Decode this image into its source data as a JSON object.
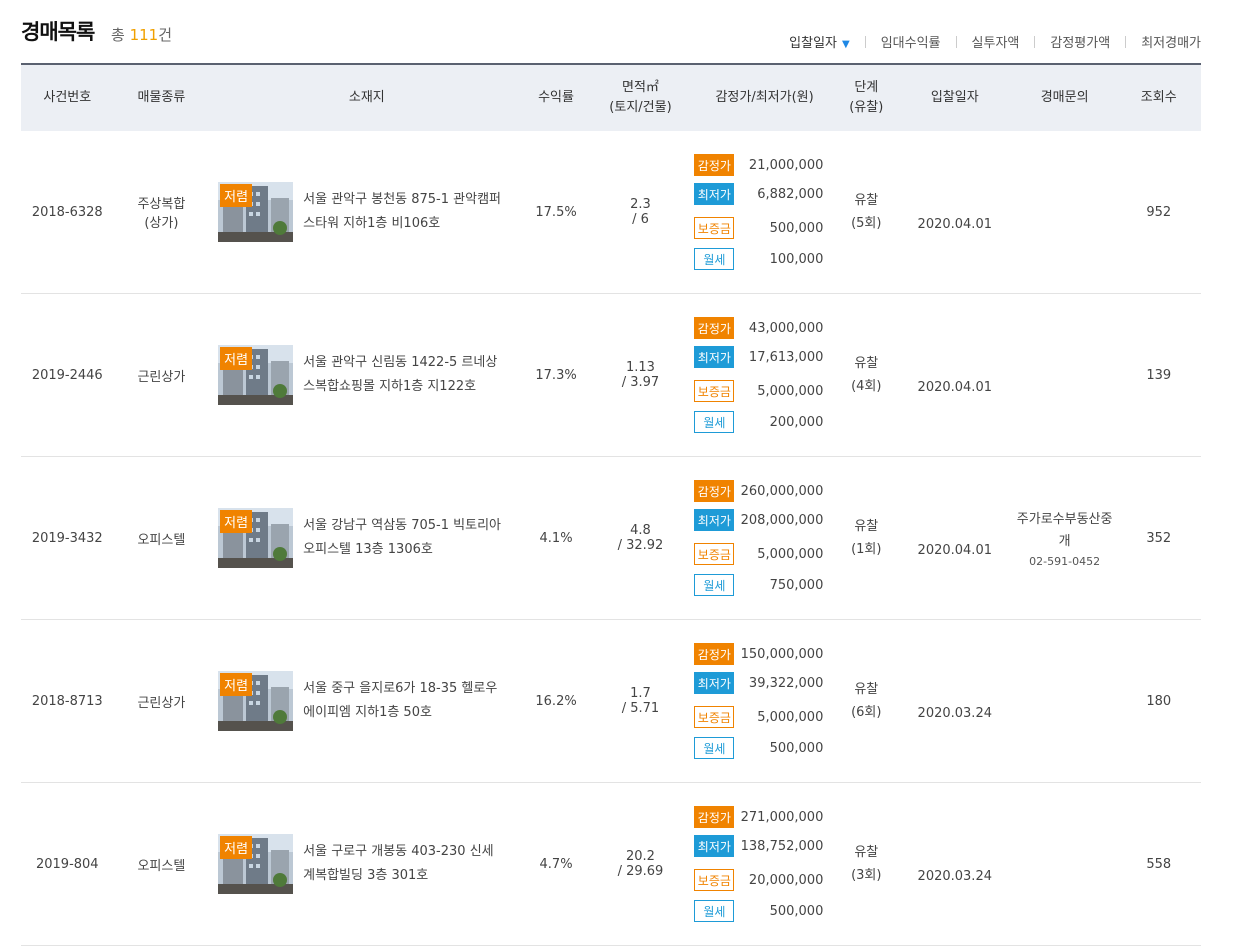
{
  "header": {
    "title": "경매목록",
    "count_prefix": "총 ",
    "count": "111",
    "count_suffix": "건"
  },
  "sort_options": [
    {
      "label": "입찰일자",
      "active": true,
      "icon": "caret-down-icon"
    },
    {
      "label": "임대수익률"
    },
    {
      "label": "실투자액"
    },
    {
      "label": "감정평가액"
    },
    {
      "label": "최저경매가"
    }
  ],
  "columns": {
    "case_no": "사건번호",
    "type": "매물종류",
    "location": "소재지",
    "yield": "수익률",
    "area_l1": "면적㎡",
    "area_l2": "(토지/건물)",
    "price": "감정가/최저가(원)",
    "stage_l1": "단계",
    "stage_l2": "(유찰)",
    "bid_date": "입찰일자",
    "inquiry": "경매문의",
    "views": "조회수"
  },
  "price_labels": {
    "appraisal": "감정가",
    "minimum": "최저가",
    "deposit": "보증금",
    "rent": "월세"
  },
  "thumb_badge": "저렴",
  "rows": [
    {
      "case_no": "2018-6328",
      "type_l1": "주상복합",
      "type_l2": "(상가)",
      "address": "서울 관악구 봉천동 875-1 관악캠퍼스타워 지하1층 비106호",
      "yield": "17.5%",
      "area_l1": "2.3",
      "area_l2": "/ 6",
      "appraisal": "21,000,000",
      "minimum": "6,882,000",
      "deposit": "500,000",
      "rent": "100,000",
      "stage_l1": "유찰",
      "stage_l2": "(5회)",
      "bid_date": "2020.04.01",
      "inquiry_l1": "",
      "inquiry_l2": "",
      "inquiry_phone": "",
      "views": "952"
    },
    {
      "case_no": "2019-2446",
      "type_l1": "근린상가",
      "type_l2": "",
      "address": "서울 관악구 신림동 1422-5 르네상스복합쇼핑몰 지하1층 지122호",
      "yield": "17.3%",
      "area_l1": "1.13",
      "area_l2": "/ 3.97",
      "appraisal": "43,000,000",
      "minimum": "17,613,000",
      "deposit": "5,000,000",
      "rent": "200,000",
      "stage_l1": "유찰",
      "stage_l2": "(4회)",
      "bid_date": "2020.04.01",
      "inquiry_l1": "",
      "inquiry_l2": "",
      "inquiry_phone": "",
      "views": "139"
    },
    {
      "case_no": "2019-3432",
      "type_l1": "오피스텔",
      "type_l2": "",
      "address": "서울 강남구 역삼동 705-1 빅토리아오피스텔 13층 1306호",
      "yield": "4.1%",
      "area_l1": "4.8",
      "area_l2": "/ 32.92",
      "appraisal": "260,000,000",
      "minimum": "208,000,000",
      "deposit": "5,000,000",
      "rent": "750,000",
      "stage_l1": "유찰",
      "stage_l2": "(1회)",
      "bid_date": "2020.04.01",
      "inquiry_l1": "주가로수부동산중",
      "inquiry_l2": "개",
      "inquiry_phone": "02-591-0452",
      "views": "352"
    },
    {
      "case_no": "2018-8713",
      "type_l1": "근린상가",
      "type_l2": "",
      "address": "서울 중구 을지로6가 18-35 헬로우에이피엠 지하1층 50호",
      "yield": "16.2%",
      "area_l1": "1.7",
      "area_l2": "/ 5.71",
      "appraisal": "150,000,000",
      "minimum": "39,322,000",
      "deposit": "5,000,000",
      "rent": "500,000",
      "stage_l1": "유찰",
      "stage_l2": "(6회)",
      "bid_date": "2020.03.24",
      "inquiry_l1": "",
      "inquiry_l2": "",
      "inquiry_phone": "",
      "views": "180"
    },
    {
      "case_no": "2019-804",
      "type_l1": "오피스텔",
      "type_l2": "",
      "address": "서울 구로구 개봉동 403-230 신세계복합빌딩 3층 301호",
      "yield": "4.7%",
      "area_l1": "20.2",
      "area_l2": "/ 29.69",
      "appraisal": "271,000,000",
      "minimum": "138,752,000",
      "deposit": "20,000,000",
      "rent": "500,000",
      "stage_l1": "유찰",
      "stage_l2": "(3회)",
      "bid_date": "2020.03.24",
      "inquiry_l1": "",
      "inquiry_l2": "",
      "inquiry_phone": "",
      "views": "558"
    }
  ]
}
